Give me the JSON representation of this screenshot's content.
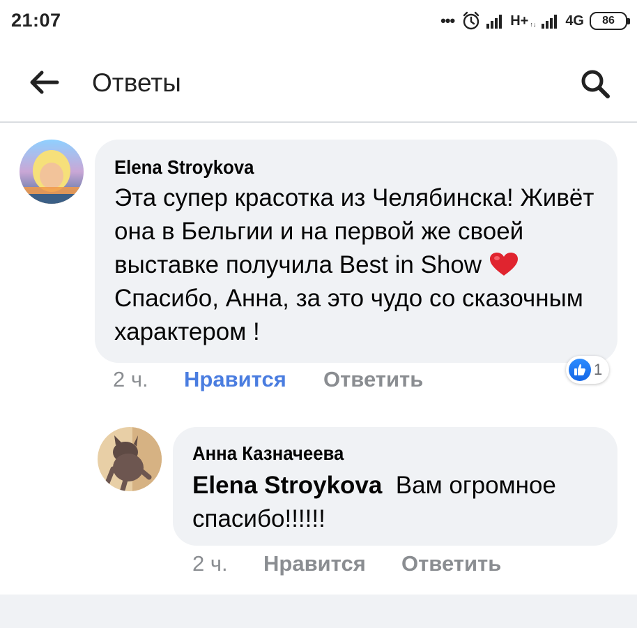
{
  "status_bar": {
    "time": "21:07",
    "dots": "•••",
    "network_1": "H+",
    "network_2": "4G",
    "battery": "86",
    "icons": [
      "alarm-icon",
      "signal-icon",
      "battery-icon"
    ]
  },
  "header": {
    "title": "Ответы",
    "back_icon": "arrow-left-icon",
    "search_icon": "search-icon"
  },
  "comments": [
    {
      "author": "Elena Stroykova",
      "text_part1": "Эта супер красотка из Челябинска! Живёт она в Бельгии и на первой же своей выставке получила Best in Show",
      "emoji": "heart-emoji",
      "text_part2": "Спасибо, Анна, за это чудо со сказочным характером !",
      "time": "2 ч.",
      "like_label": "Нравится",
      "reply_label": "Ответить",
      "reactions": {
        "icon": "like-icon",
        "count": "1"
      }
    },
    {
      "author": "Анна Казначеева",
      "mention": "Elena Stroykova",
      "text": "Вам огромное спасибо!!!!!!",
      "time": "2 ч.",
      "like_label": "Нравится",
      "reply_label": "Ответить"
    }
  ],
  "colors": {
    "bubble": "#f0f2f5",
    "liked_accent": "#4a7de0",
    "muted": "#8a8d91",
    "like_badge": "#1877f2",
    "heart": "#e0242f"
  }
}
